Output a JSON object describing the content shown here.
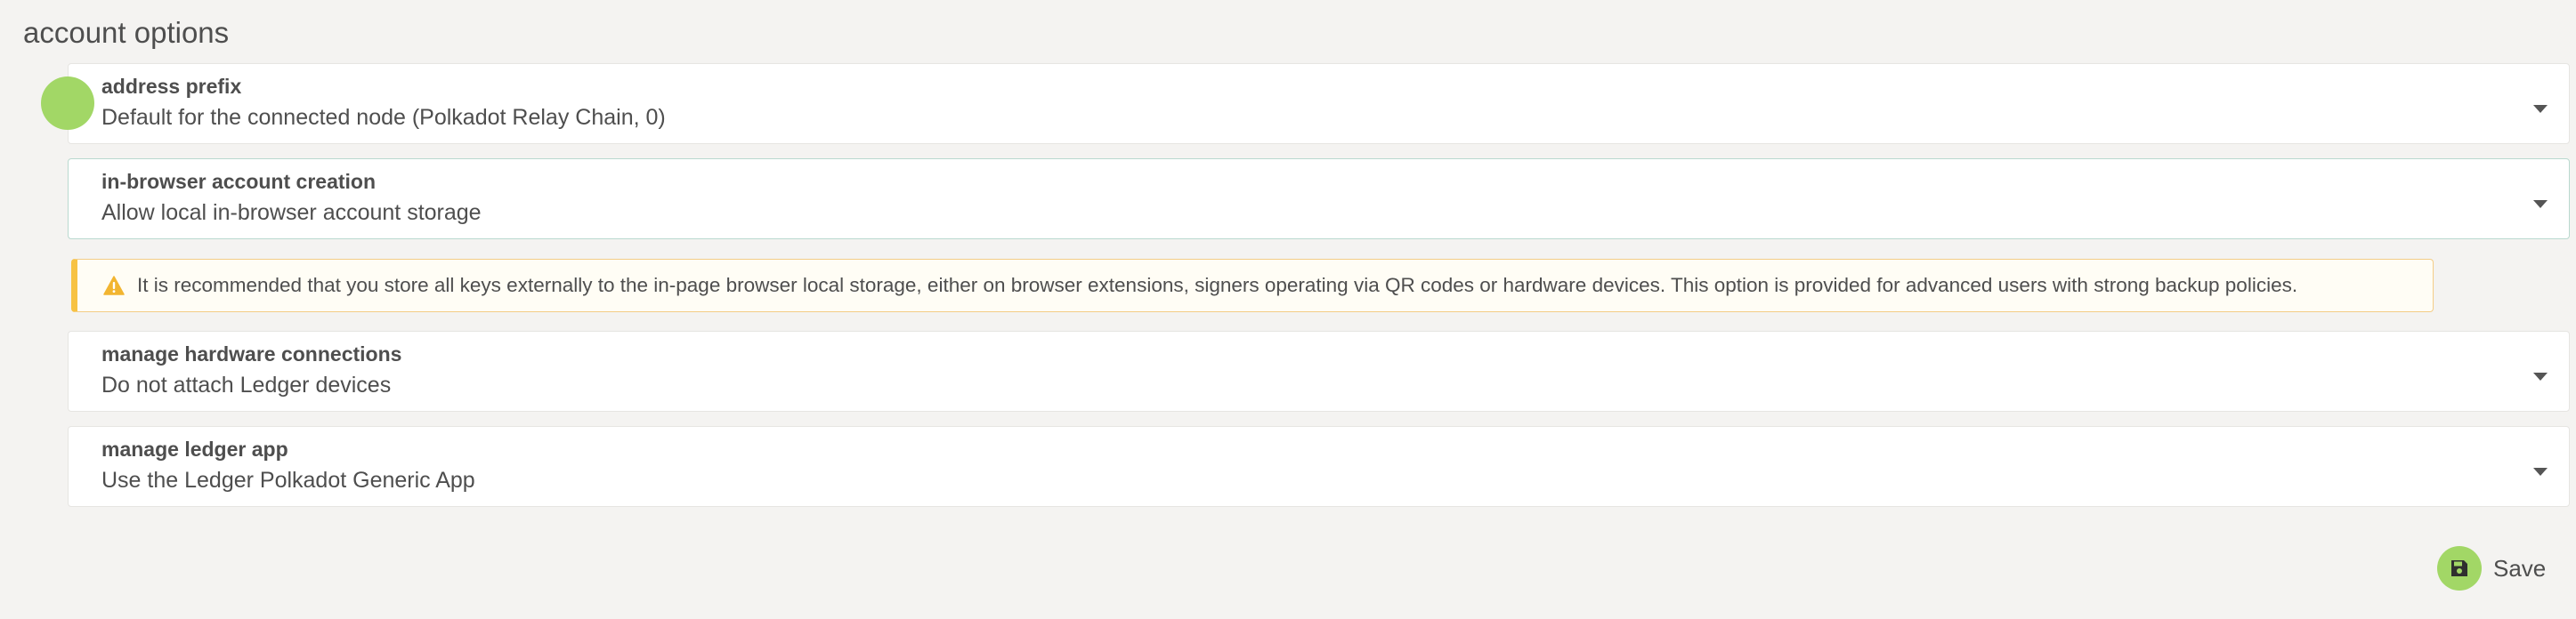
{
  "page": {
    "title": "account options"
  },
  "fields": [
    {
      "label": "address prefix",
      "value": "Default for the connected node (Polkadot Relay Chain, 0)"
    },
    {
      "label": "in-browser account creation",
      "value": "Allow local in-browser account storage"
    },
    {
      "label": "manage hardware connections",
      "value": "Do not attach Ledger devices"
    },
    {
      "label": "manage ledger app",
      "value": "Use the Ledger Polkadot Generic App"
    }
  ],
  "warning": {
    "text": "It is recommended that you store all keys externally to the in-page browser local storage, either on browser extensions, signers operating via QR codes or hardware devices. This option is provided for advanced users with strong backup policies.",
    "icon": "warning-triangle-icon"
  },
  "save": {
    "label": "Save",
    "icon": "floppy-disk-icon"
  },
  "colors": {
    "background": "#f4f3f1",
    "accent": "#a2d766",
    "warning_border": "#f7c244",
    "text": "#4e4e4e"
  }
}
